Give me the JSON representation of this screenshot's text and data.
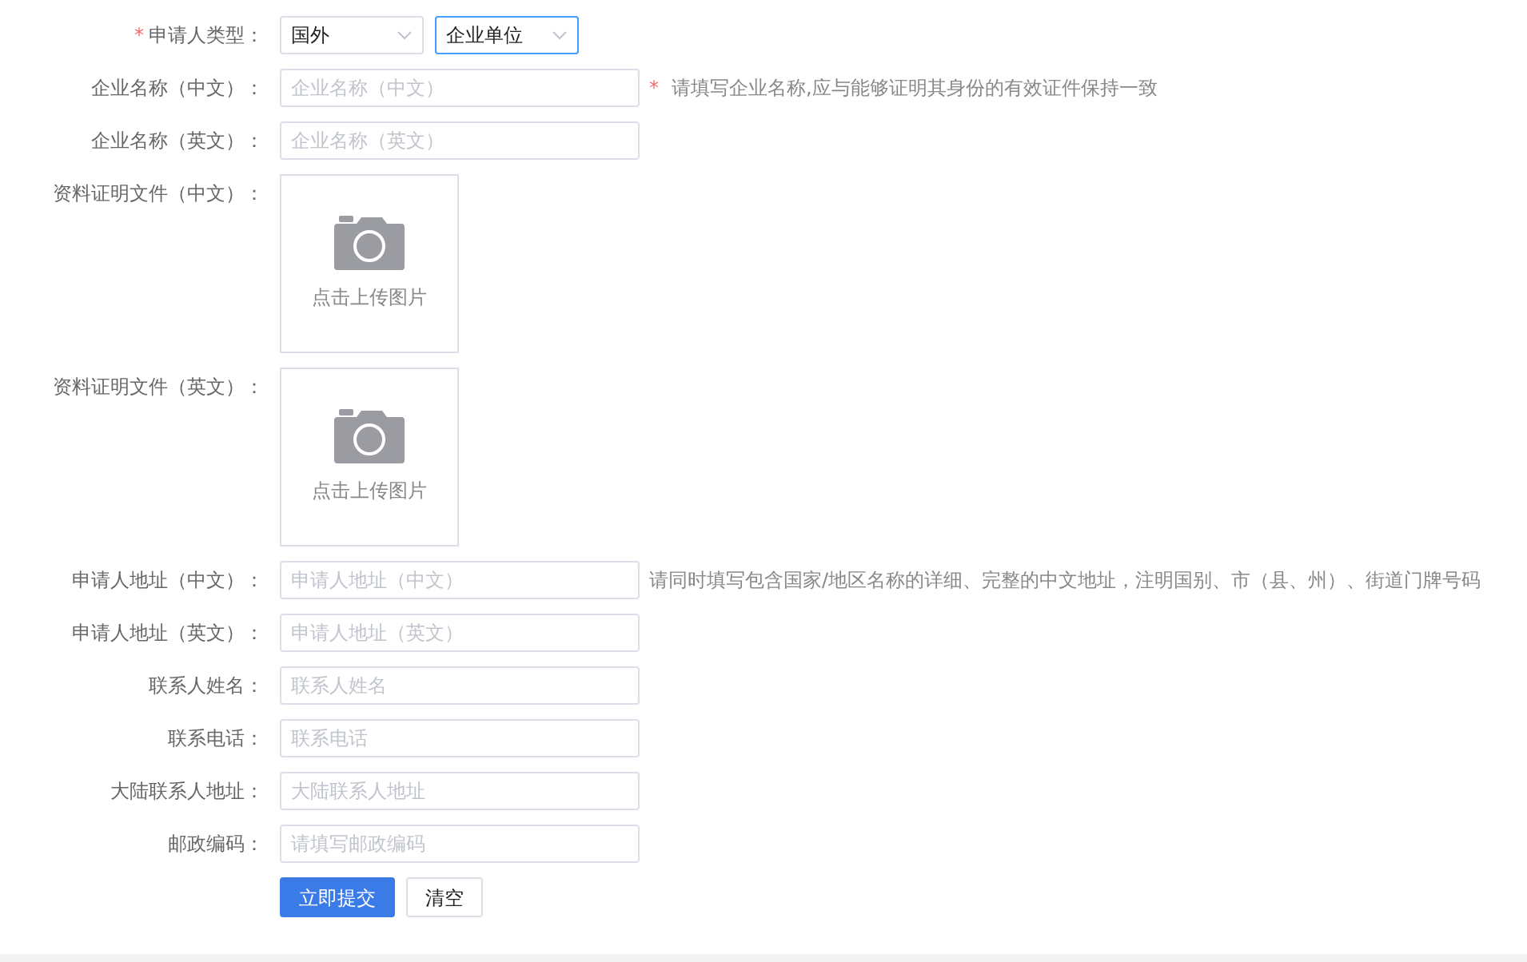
{
  "form": {
    "rows": [
      {
        "kind": "selects",
        "marker": "*",
        "label": "申请人类型：",
        "selects": [
          {
            "value": "国外",
            "focused": false
          },
          {
            "value": "企业单位",
            "focused": true
          }
        ]
      },
      {
        "kind": "text",
        "label": "企业名称（中文）：",
        "placeholder": "企业名称（中文）",
        "hint": {
          "marker": "*",
          "text": "请填写企业名称,应与能够证明其身份的有效证件保持一致"
        }
      },
      {
        "kind": "text",
        "label": "企业名称（英文）：",
        "placeholder": "企业名称（英文）"
      },
      {
        "kind": "upload",
        "label": "资料证明文件（中文）：",
        "caption": "点击上传图片"
      },
      {
        "kind": "upload",
        "label": "资料证明文件（英文）：",
        "caption": "点击上传图片"
      },
      {
        "kind": "text",
        "label": "申请人地址（中文）：",
        "placeholder": "申请人地址（中文）",
        "hint": {
          "text": "请同时填写包含国家/地区名称的详细、完整的中文地址，注明国别、市（县、州）、街道门牌号码"
        }
      },
      {
        "kind": "text",
        "label": "申请人地址（英文）：",
        "placeholder": "申请人地址（英文）"
      },
      {
        "kind": "text",
        "label": "联系人姓名：",
        "placeholder": "联系人姓名"
      },
      {
        "kind": "text",
        "label": "联系电话：",
        "placeholder": "联系电话"
      },
      {
        "kind": "text",
        "label": "大陆联系人地址：",
        "placeholder": "大陆联系人地址"
      },
      {
        "kind": "text",
        "label": "邮政编码：",
        "placeholder": "请填写邮政编码"
      }
    ],
    "buttons": [
      {
        "kind": "primary",
        "label": "立即提交"
      },
      {
        "kind": "default",
        "label": "清空"
      }
    ]
  }
}
